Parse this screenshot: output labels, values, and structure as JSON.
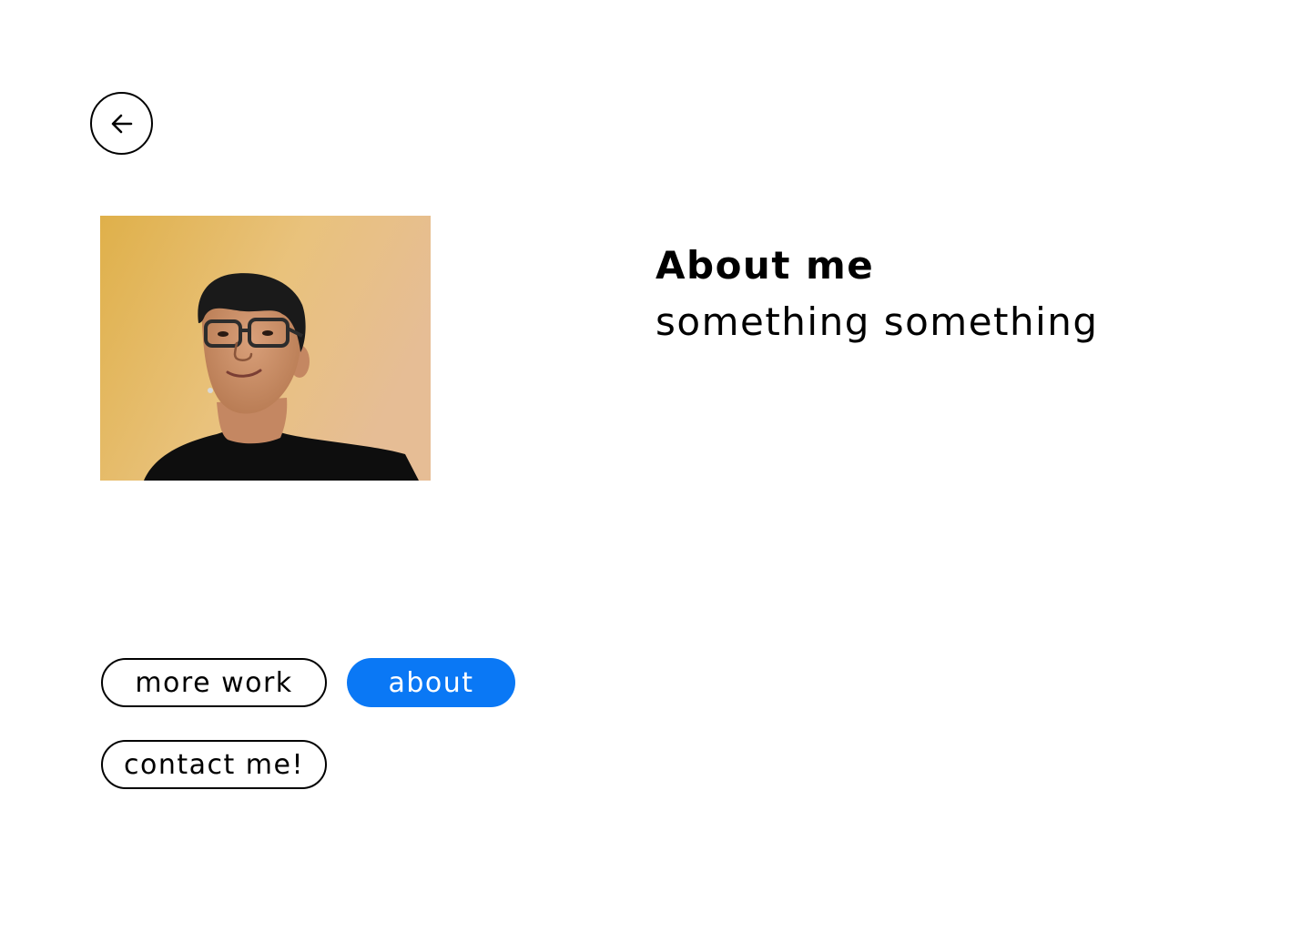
{
  "header": {
    "back_icon": "arrow-left-icon"
  },
  "profile": {
    "photo_alt": "portrait photo"
  },
  "about": {
    "heading": "About me",
    "subtext": "something something"
  },
  "nav": {
    "more_work_label": "more work",
    "about_label": "about",
    "contact_label": "contact me!"
  },
  "colors": {
    "accent": "#0a78f5",
    "text": "#000000",
    "background": "#ffffff",
    "photo_background": "#e6bd6a"
  }
}
